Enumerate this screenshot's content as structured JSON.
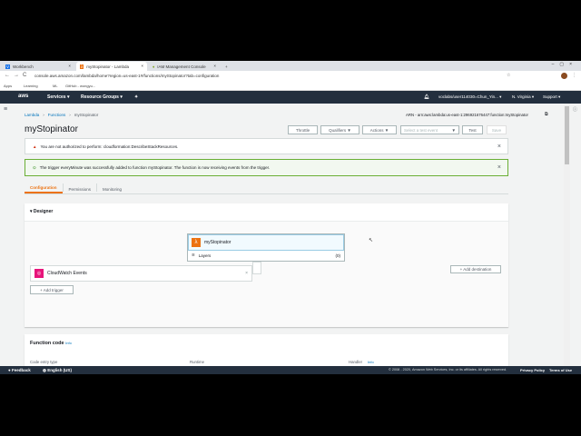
{
  "browser": {
    "tabs": [
      {
        "label": "Workbench"
      },
      {
        "label": "myStopinator - Lambda"
      },
      {
        "label": "IAM Management Console"
      }
    ],
    "new_tab": "+",
    "url": "console.aws.amazon.com/lambda/home?region=us-east-1#/functions/myStopinator?tab=configuration",
    "bookmarks": [
      "Apps",
      "Learning",
      "ML",
      "GitHub - wongyu..."
    ]
  },
  "awsnav": {
    "logo": "aws",
    "services": "Services ▾",
    "resource_groups": "Resource Groups ▾",
    "account": "voclabs/user114030=Chun_Yin... ▾",
    "region": "N. Virginia ▾",
    "support": "Support ▾"
  },
  "breadcrumb": [
    "Lambda",
    "Functions",
    "myStopinator"
  ],
  "arn": "ARN - arn:aws:lambda:us-east-1:296921676447:function:myStopinator",
  "title": "myStopinator",
  "toolbar": {
    "throttle": "Throttle",
    "qualifiers": "Qualifiers ▼",
    "actions": "Actions ▼",
    "test_event_placeholder": "Select a test event",
    "test": "Test",
    "save": "Save"
  },
  "error_banner": "You are not authorized to perform: cloudformation:DescribeStackResources.",
  "success_banner": "The trigger everyMinute was successfully added to function myStopinator. The function is now receiving events from the trigger.",
  "tabs": [
    {
      "label": "Configuration"
    },
    {
      "label": "Permissions"
    },
    {
      "label": "Monitoring"
    }
  ],
  "designer": {
    "heading": "Designer",
    "function_name": "myStopinator",
    "layers": "Layers",
    "layers_count": "(0)",
    "trigger": "CloudWatch Events",
    "add_trigger": "+ Add trigger",
    "add_destination": "+ Add destination"
  },
  "function_code": {
    "heading": "Function code",
    "info": "Info",
    "col1": "Code entry type",
    "col2": "Runtime",
    "col3": "Handler",
    "col3_info": "Info"
  },
  "footer": {
    "feedback": "Feedback",
    "language": "English (US)",
    "copyright": "© 2008 - 2020, Amazon Web Services, Inc. or its affiliates. All rights reserved.",
    "privacy": "Privacy Policy",
    "terms": "Terms of Use"
  },
  "colors": {
    "accent": "#ec7211",
    "nav": "#232f3e",
    "success": "#1d8102",
    "error": "#d13212"
  }
}
